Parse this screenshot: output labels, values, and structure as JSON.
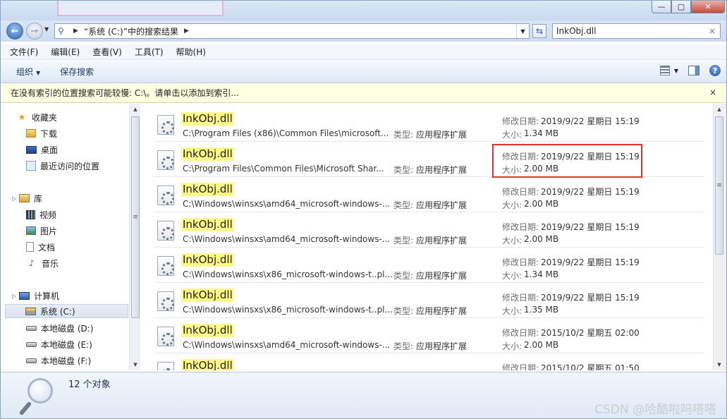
{
  "window": {
    "controls": {
      "minimize": "—",
      "maximize": "▢",
      "close": "✕"
    }
  },
  "address": {
    "path": "“系统 (C:)”中的搜索结果",
    "search_value": "InkObj.dll",
    "search_clear": "×"
  },
  "menu": [
    "文件(F)",
    "编辑(E)",
    "查看(V)",
    "工具(T)",
    "帮助(H)"
  ],
  "toolbar": {
    "organize": "组织",
    "save_search": "保存搜索"
  },
  "infobar": {
    "text": "在没有索引的位置搜索可能较慢: C:\\。请单击以添加到索引...",
    "close": "×"
  },
  "sidebar": {
    "favorites": {
      "label": "收藏夹",
      "items": [
        "下载",
        "桌面",
        "最近访问的位置"
      ]
    },
    "libraries": {
      "label": "库",
      "items": [
        "视频",
        "图片",
        "文档",
        "音乐"
      ]
    },
    "computer": {
      "label": "计算机",
      "items": [
        "系统 (C:)",
        "本地磁盘 (D:)",
        "本地磁盘 (E:)",
        "本地磁盘 (F:)"
      ]
    }
  },
  "results_meta": {
    "date_label": "修改日期:",
    "size_label": "大小:",
    "type_label": "类型:"
  },
  "results": [
    {
      "name": "InkObj.dll",
      "path": "C:\\Program Files (x86)\\Common Files\\microsoft...",
      "type": "应用程序扩展",
      "date": "2019/9/22 星期日 15:19",
      "size": "1.34 MB"
    },
    {
      "name": "InkObj.dll",
      "path": "C:\\Program Files\\Common Files\\Microsoft Shar...",
      "type": "应用程序扩展",
      "date": "2019/9/22 星期日 15:19",
      "size": "2.00 MB"
    },
    {
      "name": "InkObj.dll",
      "path": "C:\\Windows\\winsxs\\amd64_microsoft-windows-...",
      "type": "应用程序扩展",
      "date": "2019/9/22 星期日 15:19",
      "size": "2.00 MB"
    },
    {
      "name": "InkObj.dll",
      "path": "C:\\Windows\\winsxs\\amd64_microsoft-windows-...",
      "type": "应用程序扩展",
      "date": "2019/9/22 星期日 15:19",
      "size": "2.00 MB"
    },
    {
      "name": "InkObj.dll",
      "path": "C:\\Windows\\winsxs\\x86_microsoft-windows-t..pl...",
      "type": "应用程序扩展",
      "date": "2019/9/22 星期日 15:19",
      "size": "1.34 MB"
    },
    {
      "name": "InkObj.dll",
      "path": "C:\\Windows\\winsxs\\x86_microsoft-windows-t..pl...",
      "type": "应用程序扩展",
      "date": "2019/9/22 星期日 15:19",
      "size": "1.35 MB"
    },
    {
      "name": "InkObj.dll",
      "path": "C:\\Windows\\winsxs\\amd64_microsoft-windows-...",
      "type": "应用程序扩展",
      "date": "2015/10/2 星期五 02:00",
      "size": "2.00 MB"
    },
    {
      "name": "InkObj.dll",
      "path": "",
      "type": "",
      "date": "2015/10/2 星期五 01:50",
      "size": ""
    }
  ],
  "status": {
    "count": "12 个对象"
  },
  "watermark": "CSDN @哈酷啦吗嗒嗒",
  "colors": {
    "highlight": "#fff88a",
    "annotation_box": "#e4312b",
    "infobar_bg": "#ffffe1"
  }
}
